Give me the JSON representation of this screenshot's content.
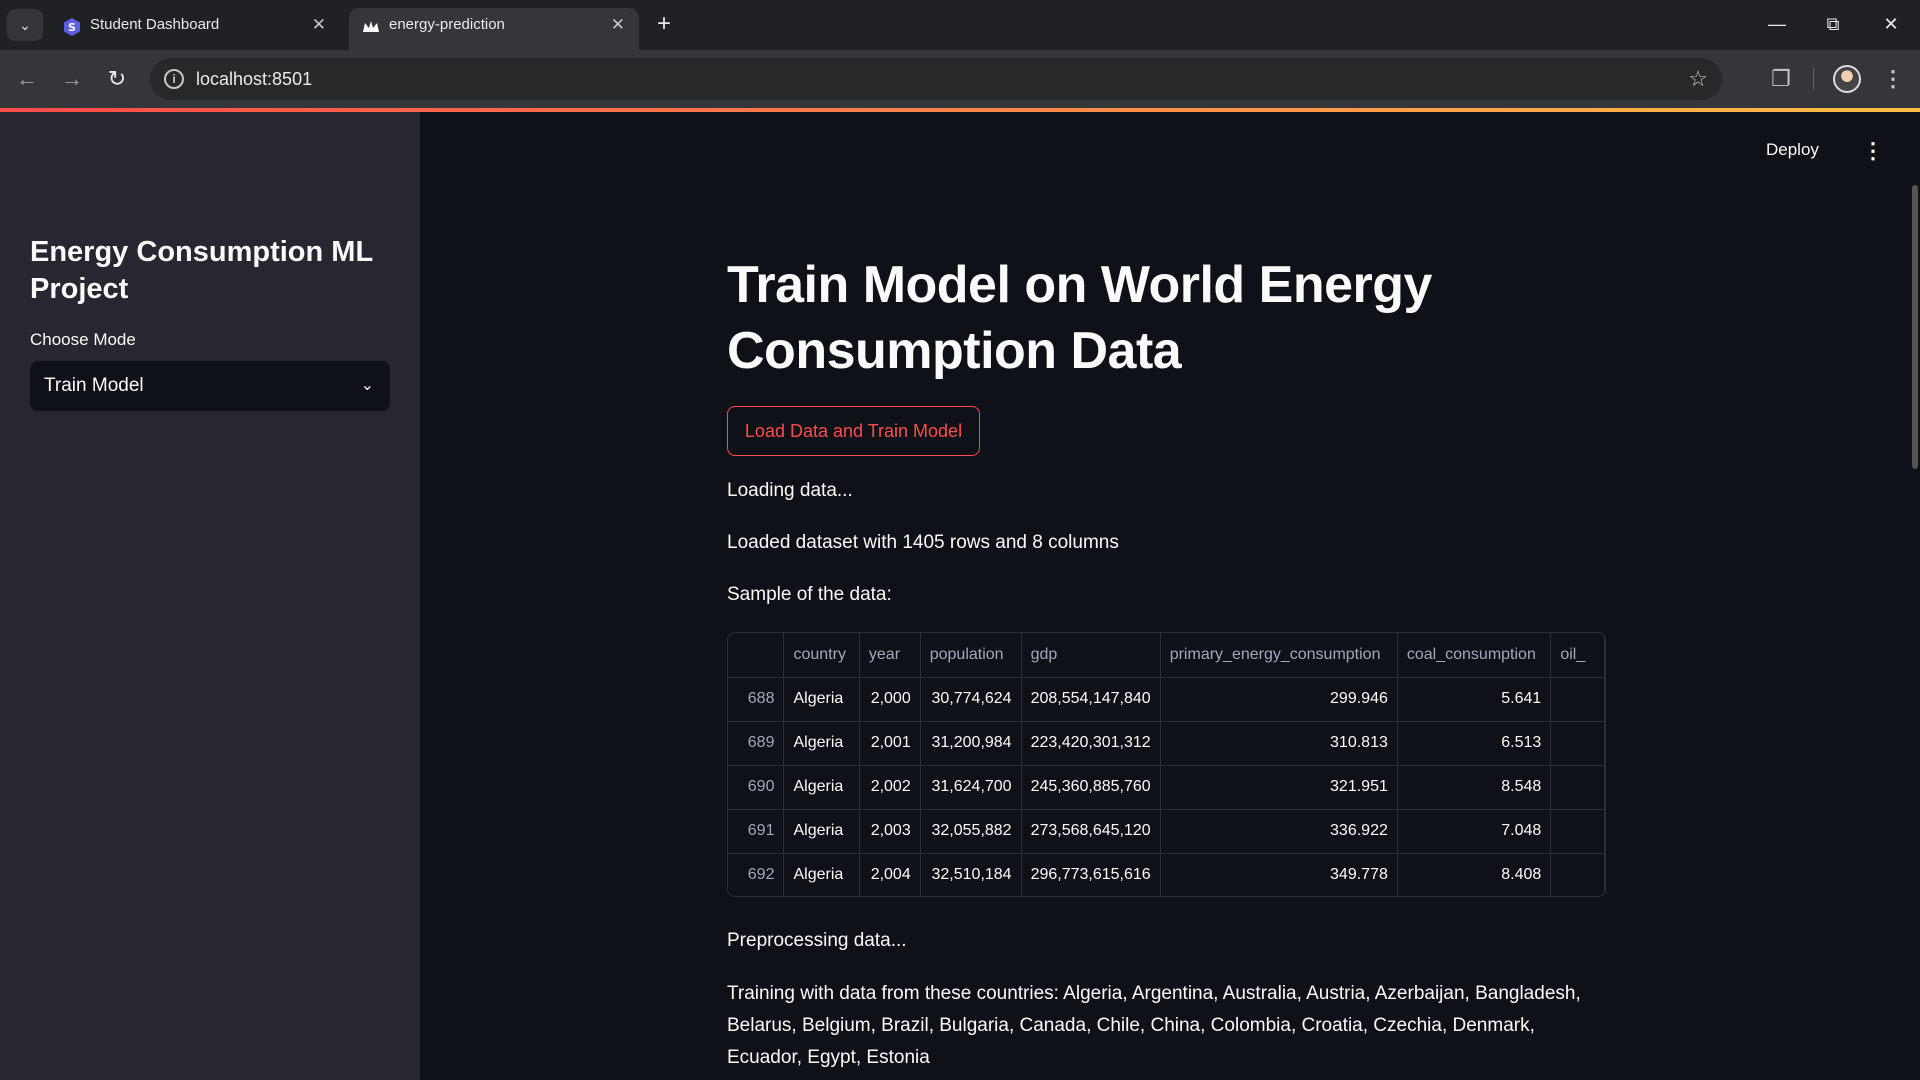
{
  "browser": {
    "tabs": [
      {
        "title": "Student Dashboard",
        "active": false,
        "favicon": "s-logo-icon"
      },
      {
        "title": "energy-prediction",
        "active": true,
        "favicon": "streamlit-crown-icon"
      }
    ],
    "url": "localhost:8501"
  },
  "header": {
    "deploy_label": "Deploy"
  },
  "sidebar": {
    "title": "Energy Consumption ML Project",
    "mode_label": "Choose Mode",
    "mode_value": "Train Model"
  },
  "main": {
    "title": "Train Model on World Energy Consumption Data",
    "button_label": "Load Data and Train Model",
    "loading_text": "Loading data...",
    "loaded_text": "Loaded dataset with 1405 rows and 8 columns",
    "sample_label": "Sample of the data:",
    "table": {
      "columns": [
        "",
        "country",
        "year",
        "population",
        "gdp",
        "primary_energy_consumption",
        "coal_consumption",
        "oil_"
      ],
      "rows": [
        [
          "688",
          "Algeria",
          "2,000",
          "30,774,624",
          "208,554,147,840",
          "299.946",
          "5.641",
          ""
        ],
        [
          "689",
          "Algeria",
          "2,001",
          "31,200,984",
          "223,420,301,312",
          "310.813",
          "6.513",
          ""
        ],
        [
          "690",
          "Algeria",
          "2,002",
          "31,624,700",
          "245,360,885,760",
          "321.951",
          "8.548",
          ""
        ],
        [
          "691",
          "Algeria",
          "2,003",
          "32,055,882",
          "273,568,645,120",
          "336.922",
          "7.048",
          ""
        ],
        [
          "692",
          "Algeria",
          "2,004",
          "32,510,184",
          "296,773,615,616",
          "349.778",
          "8.408",
          ""
        ]
      ]
    },
    "preprocessing_text": "Preprocessing data...",
    "countries_text": "Training with data from these countries: Algeria, Argentina, Australia, Austria, Azerbaijan, Bangladesh, Belarus, Belgium, Brazil, Bulgaria, Canada, Chile, China, Colombia, Croatia, Czechia, Denmark, Ecuador, Egypt, Estonia"
  },
  "colors": {
    "accent": "#ff4b4b",
    "background": "#0e1117",
    "sidebar": "#262730"
  }
}
